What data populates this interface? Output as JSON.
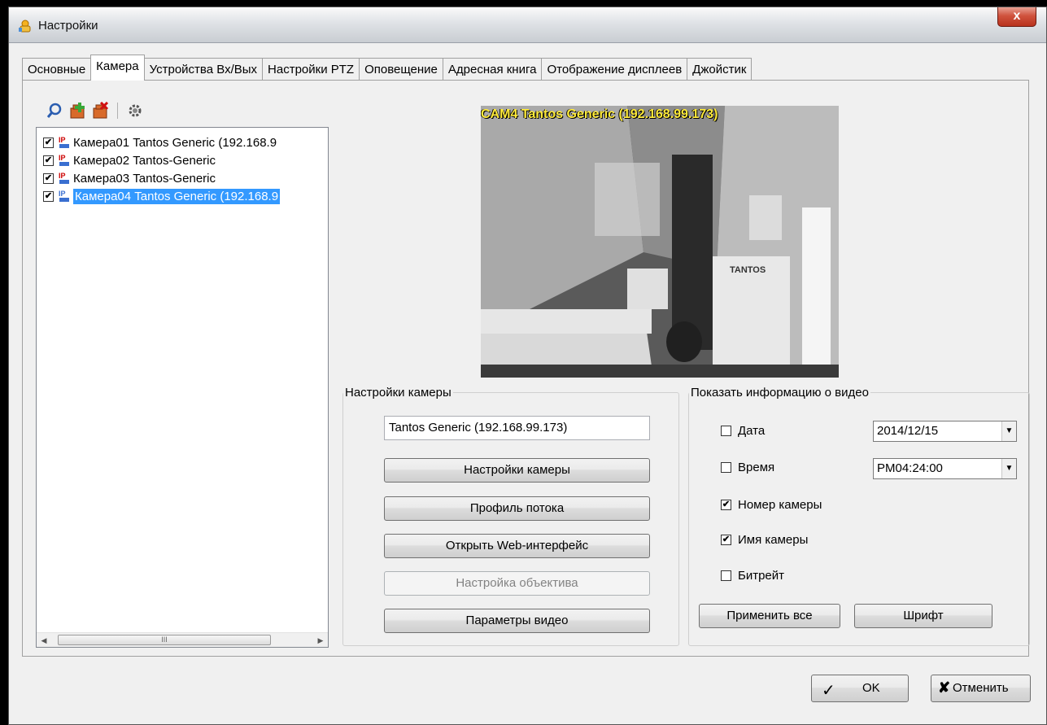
{
  "window": {
    "title": "Настройки",
    "close_label": "x"
  },
  "tabs": [
    {
      "label": "Основные",
      "active": false
    },
    {
      "label": "Камера",
      "active": true
    },
    {
      "label": "Устройства Вх/Вых",
      "active": false
    },
    {
      "label": "Настройки PTZ",
      "active": false
    },
    {
      "label": "Оповещение",
      "active": false
    },
    {
      "label": "Адресная книга",
      "active": false
    },
    {
      "label": "Отображение дисплеев",
      "active": false
    },
    {
      "label": "Джойстик",
      "active": false
    }
  ],
  "toolbar": {
    "icons": [
      "search-icon",
      "add-camera-icon",
      "delete-camera-icon",
      "settings-gear-icon"
    ]
  },
  "camera_list": {
    "items": [
      {
        "label": "Камера01 Tantos Generic (192.168.9",
        "checked": "✔",
        "selected": false
      },
      {
        "label": "Камера02 Tantos-Generic",
        "checked": "✔",
        "selected": false
      },
      {
        "label": "Камера03 Tantos-Generic",
        "checked": "✔",
        "selected": false
      },
      {
        "label": "Камера04 Tantos Generic (192.168.9",
        "checked": "✔",
        "selected": true
      }
    ],
    "scroll_thumb": "III"
  },
  "video": {
    "overlay_text": "CAM4 Tantos Generic (192.168.99.173)",
    "wall_brand_text": "TANTOS"
  },
  "camera_settings": {
    "legend": "Настройки камеры",
    "name_value": "Tantos Generic (192.168.99.173)",
    "buttons": {
      "camera_settings": "Настройки камеры",
      "stream_profile": "Профиль потока",
      "open_web": "Открыть Web-интерфейс",
      "lens_setup": "Настройка объектива",
      "video_params": "Параметры видео"
    }
  },
  "video_info": {
    "legend": "Показать информацию о видео",
    "date_label": "Дата",
    "date_value": "2014/12/15",
    "time_label": "Время",
    "time_value": "PM04:24:00",
    "camera_number_label": "Номер камеры",
    "camera_name_label": "Имя камеры",
    "bitrate_label": "Битрейт",
    "checked_mark": "✔",
    "apply_all": "Применить все",
    "font": "Шрифт"
  },
  "dialog": {
    "ok": "OK",
    "cancel": "Отменить"
  }
}
